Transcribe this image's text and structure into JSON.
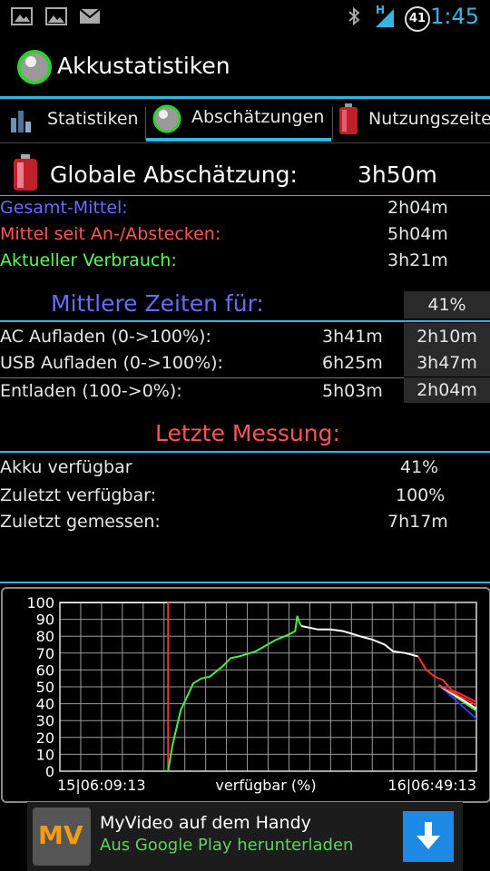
{
  "status_bar": {
    "time": "1:45",
    "battery_level": "41",
    "network_type": "H"
  },
  "app": {
    "title": "Akkustatistiken"
  },
  "tabs": [
    {
      "label": "Statistiken",
      "icon": "bars-icon",
      "selected": false
    },
    {
      "label": "Abschätzungen",
      "icon": "green-ball-icon",
      "selected": true
    },
    {
      "label": "Nutzungszeiten",
      "icon": "red-battery-icon",
      "selected": false
    }
  ],
  "global": {
    "label": "Globale Abschätzung:",
    "value": "3h50m"
  },
  "averages": [
    {
      "label": "Gesamt-Mittel:",
      "value": "2h04m",
      "color": "#6a6aff"
    },
    {
      "label": "Mittel seit An-/Abstecken:",
      "value": "5h04m",
      "color": "#ff5555"
    },
    {
      "label": "Aktueller Verbrauch:",
      "value": "3h21m",
      "color": "#55ff55"
    }
  ],
  "mean_times": {
    "heading": "Mittlere Zeiten für:",
    "heading_color": "#6a6aff",
    "percent": "41%",
    "rows": [
      {
        "label": "AC Aufladen (0->100%):",
        "full": "3h41m",
        "at_percent": "2h10m"
      },
      {
        "label": "USB Aufladen (0->100%):",
        "full": "6h25m",
        "at_percent": "3h47m"
      },
      {
        "label": "Entladen (100->0%):",
        "full": "5h03m",
        "at_percent": "2h04m"
      }
    ]
  },
  "last_measurement": {
    "heading": "Letzte Messung:",
    "heading_color": "#ff5555",
    "rows": [
      {
        "label": "Akku verfügbar",
        "value": "41%"
      },
      {
        "label": "Zuletzt verfügbar:",
        "value": "100%"
      },
      {
        "label": "Zuletzt gemessen:",
        "value": "7h17m"
      }
    ]
  },
  "chart_data": {
    "type": "line",
    "xlabel": "verfügbar (%)",
    "x_start_label": "15|06:09:13",
    "x_end_label": "16|06:49:13",
    "ylim": [
      0,
      100
    ],
    "y_ticks": [
      "100",
      "90",
      "80",
      "70",
      "60",
      "50",
      "40",
      "30",
      "20",
      "10",
      "0"
    ],
    "grid": true,
    "series": [
      {
        "color": "#ffffff",
        "x": [
          0,
          0.26
        ],
        "y": [
          100,
          100
        ]
      },
      {
        "color": "#ff3030",
        "x": [
          0.26,
          0.26
        ],
        "y": [
          100,
          0
        ]
      },
      {
        "color": "#44ee44",
        "x": [
          0.26,
          0.27,
          0.29,
          0.32,
          0.34,
          0.36,
          0.39,
          0.41,
          0.43,
          0.47,
          0.52,
          0.55,
          0.565,
          0.57,
          0.575,
          0.58
        ],
        "y": [
          0,
          15,
          36,
          52,
          55,
          56,
          62,
          67,
          68,
          71,
          78,
          81,
          83,
          92,
          88,
          86
        ]
      },
      {
        "color": "#ffffff",
        "x": [
          0.58,
          0.62,
          0.65,
          0.68,
          0.72,
          0.75,
          0.78,
          0.8,
          0.83,
          0.86
        ],
        "y": [
          86,
          84,
          84,
          83,
          80,
          78,
          75,
          71,
          70,
          68
        ]
      },
      {
        "color": "#ff3030",
        "x": [
          0.86,
          0.88,
          0.9,
          0.92,
          0.94,
          0.96,
          1.0,
          1.06
        ],
        "y": [
          68,
          60,
          56,
          54,
          48,
          46,
          41,
          33
        ]
      },
      {
        "color": "#2b3bff",
        "x": [
          0.91,
          1.14
        ],
        "y": [
          51,
          0
        ]
      },
      {
        "color": "#44ee44",
        "x": [
          0.91,
          1.21
        ],
        "y": [
          51,
          0
        ]
      },
      {
        "color": "#ffffff",
        "x": [
          0.91,
          1.24
        ],
        "y": [
          51,
          0
        ]
      },
      {
        "color": "#ff3030",
        "x": [
          0.91,
          1.3
        ],
        "y": [
          51,
          0
        ]
      }
    ]
  },
  "ad": {
    "title": "MyVideo auf dem Handy",
    "subtitle": "Aus Google Play herunterladen",
    "subtitle_color": "#5fd35f",
    "logo_text": "MV"
  }
}
